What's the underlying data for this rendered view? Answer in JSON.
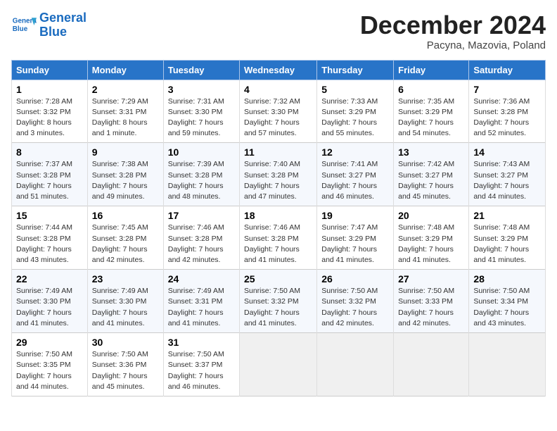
{
  "logo": {
    "line1": "General",
    "line2": "Blue"
  },
  "title": "December 2024",
  "subtitle": "Pacyna, Mazovia, Poland",
  "days_of_week": [
    "Sunday",
    "Monday",
    "Tuesday",
    "Wednesday",
    "Thursday",
    "Friday",
    "Saturday"
  ],
  "weeks": [
    [
      {
        "day": "1",
        "info": "Sunrise: 7:28 AM\nSunset: 3:32 PM\nDaylight: 8 hours\nand 3 minutes."
      },
      {
        "day": "2",
        "info": "Sunrise: 7:29 AM\nSunset: 3:31 PM\nDaylight: 8 hours\nand 1 minute."
      },
      {
        "day": "3",
        "info": "Sunrise: 7:31 AM\nSunset: 3:30 PM\nDaylight: 7 hours\nand 59 minutes."
      },
      {
        "day": "4",
        "info": "Sunrise: 7:32 AM\nSunset: 3:30 PM\nDaylight: 7 hours\nand 57 minutes."
      },
      {
        "day": "5",
        "info": "Sunrise: 7:33 AM\nSunset: 3:29 PM\nDaylight: 7 hours\nand 55 minutes."
      },
      {
        "day": "6",
        "info": "Sunrise: 7:35 AM\nSunset: 3:29 PM\nDaylight: 7 hours\nand 54 minutes."
      },
      {
        "day": "7",
        "info": "Sunrise: 7:36 AM\nSunset: 3:28 PM\nDaylight: 7 hours\nand 52 minutes."
      }
    ],
    [
      {
        "day": "8",
        "info": "Sunrise: 7:37 AM\nSunset: 3:28 PM\nDaylight: 7 hours\nand 51 minutes."
      },
      {
        "day": "9",
        "info": "Sunrise: 7:38 AM\nSunset: 3:28 PM\nDaylight: 7 hours\nand 49 minutes."
      },
      {
        "day": "10",
        "info": "Sunrise: 7:39 AM\nSunset: 3:28 PM\nDaylight: 7 hours\nand 48 minutes."
      },
      {
        "day": "11",
        "info": "Sunrise: 7:40 AM\nSunset: 3:28 PM\nDaylight: 7 hours\nand 47 minutes."
      },
      {
        "day": "12",
        "info": "Sunrise: 7:41 AM\nSunset: 3:27 PM\nDaylight: 7 hours\nand 46 minutes."
      },
      {
        "day": "13",
        "info": "Sunrise: 7:42 AM\nSunset: 3:27 PM\nDaylight: 7 hours\nand 45 minutes."
      },
      {
        "day": "14",
        "info": "Sunrise: 7:43 AM\nSunset: 3:27 PM\nDaylight: 7 hours\nand 44 minutes."
      }
    ],
    [
      {
        "day": "15",
        "info": "Sunrise: 7:44 AM\nSunset: 3:28 PM\nDaylight: 7 hours\nand 43 minutes."
      },
      {
        "day": "16",
        "info": "Sunrise: 7:45 AM\nSunset: 3:28 PM\nDaylight: 7 hours\nand 42 minutes."
      },
      {
        "day": "17",
        "info": "Sunrise: 7:46 AM\nSunset: 3:28 PM\nDaylight: 7 hours\nand 42 minutes."
      },
      {
        "day": "18",
        "info": "Sunrise: 7:46 AM\nSunset: 3:28 PM\nDaylight: 7 hours\nand 41 minutes."
      },
      {
        "day": "19",
        "info": "Sunrise: 7:47 AM\nSunset: 3:29 PM\nDaylight: 7 hours\nand 41 minutes."
      },
      {
        "day": "20",
        "info": "Sunrise: 7:48 AM\nSunset: 3:29 PM\nDaylight: 7 hours\nand 41 minutes."
      },
      {
        "day": "21",
        "info": "Sunrise: 7:48 AM\nSunset: 3:29 PM\nDaylight: 7 hours\nand 41 minutes."
      }
    ],
    [
      {
        "day": "22",
        "info": "Sunrise: 7:49 AM\nSunset: 3:30 PM\nDaylight: 7 hours\nand 41 minutes."
      },
      {
        "day": "23",
        "info": "Sunrise: 7:49 AM\nSunset: 3:30 PM\nDaylight: 7 hours\nand 41 minutes."
      },
      {
        "day": "24",
        "info": "Sunrise: 7:49 AM\nSunset: 3:31 PM\nDaylight: 7 hours\nand 41 minutes."
      },
      {
        "day": "25",
        "info": "Sunrise: 7:50 AM\nSunset: 3:32 PM\nDaylight: 7 hours\nand 41 minutes."
      },
      {
        "day": "26",
        "info": "Sunrise: 7:50 AM\nSunset: 3:32 PM\nDaylight: 7 hours\nand 42 minutes."
      },
      {
        "day": "27",
        "info": "Sunrise: 7:50 AM\nSunset: 3:33 PM\nDaylight: 7 hours\nand 42 minutes."
      },
      {
        "day": "28",
        "info": "Sunrise: 7:50 AM\nSunset: 3:34 PM\nDaylight: 7 hours\nand 43 minutes."
      }
    ],
    [
      {
        "day": "29",
        "info": "Sunrise: 7:50 AM\nSunset: 3:35 PM\nDaylight: 7 hours\nand 44 minutes."
      },
      {
        "day": "30",
        "info": "Sunrise: 7:50 AM\nSunset: 3:36 PM\nDaylight: 7 hours\nand 45 minutes."
      },
      {
        "day": "31",
        "info": "Sunrise: 7:50 AM\nSunset: 3:37 PM\nDaylight: 7 hours\nand 46 minutes."
      },
      null,
      null,
      null,
      null
    ]
  ]
}
